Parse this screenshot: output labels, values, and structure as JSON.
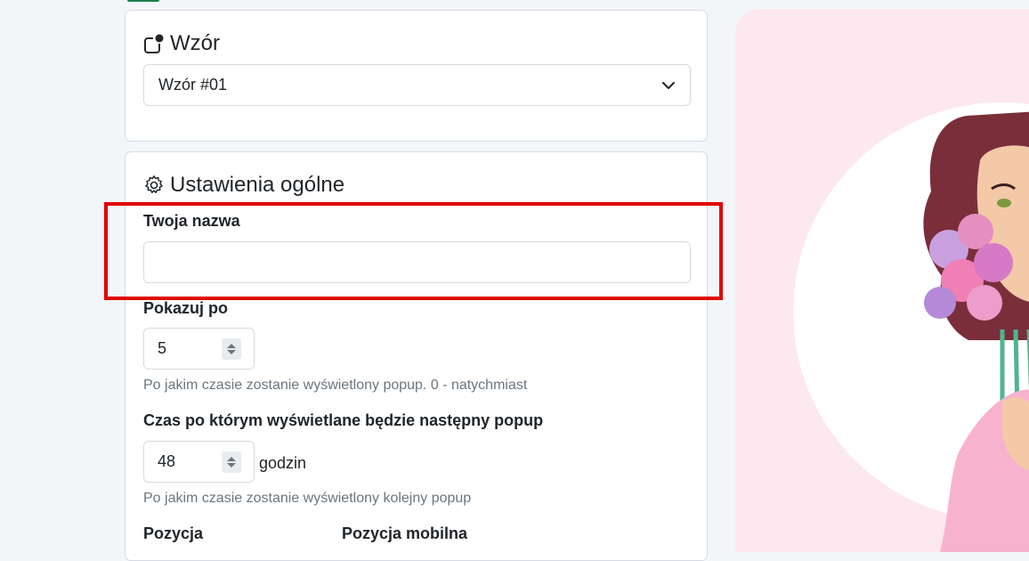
{
  "pattern_card": {
    "title": "Wzór",
    "selected": "Wzór #01"
  },
  "general_card": {
    "title": "Ustawienia ogólne",
    "name_label": "Twoja nazwa",
    "name_value": "",
    "show_after_label": "Pokazuj po",
    "show_after_value": "5",
    "show_after_help": "Po jakim czasie zostanie wyświetlony popup. 0 - natychmiast",
    "next_label": "Czas po którym wyświetlane będzie następny popup",
    "next_value": "48",
    "next_unit": "godzin",
    "next_help": "Po jakim czasie zostanie wyświetlony kolejny popup",
    "position_label": "Pozycja",
    "mobile_position_label": "Pozycja mobilna"
  },
  "colors": {
    "highlight": "#e00000",
    "preview_bg": "#fde8ef",
    "accent": "#1a7f4b"
  },
  "icons": {
    "pattern": "pattern-icon",
    "settings": "gear-icon",
    "dropdown": "chevron-down-icon"
  }
}
